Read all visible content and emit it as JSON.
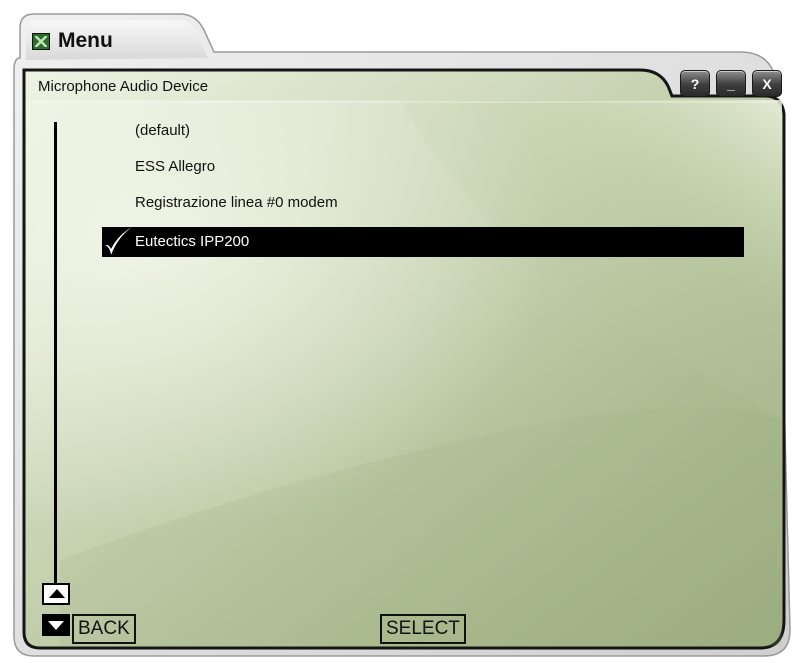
{
  "window": {
    "title": "Menu",
    "icon": "app-logo-icon"
  },
  "panel": {
    "title": "Microphone Audio Device"
  },
  "window_buttons": [
    {
      "label": "?",
      "name": "help-button"
    },
    {
      "label": "_",
      "name": "minimize-button"
    },
    {
      "label": "X",
      "name": "close-button"
    }
  ],
  "devices": [
    {
      "label": "(default)",
      "selected": false
    },
    {
      "label": "ESS Allegro",
      "selected": false
    },
    {
      "label": "Registrazione linea #0 modem",
      "selected": false
    },
    {
      "label": "Eutectics IPP200",
      "selected": true
    }
  ],
  "controls": {
    "back_label": "BACK",
    "select_label": "SELECT"
  },
  "colors": {
    "panel_light": "#e8efd9",
    "panel_mid": "#bccaa2",
    "panel_dark": "#8ea073",
    "frame": "#151515",
    "selection_bg": "#000000",
    "selection_text": "#ffffff"
  }
}
